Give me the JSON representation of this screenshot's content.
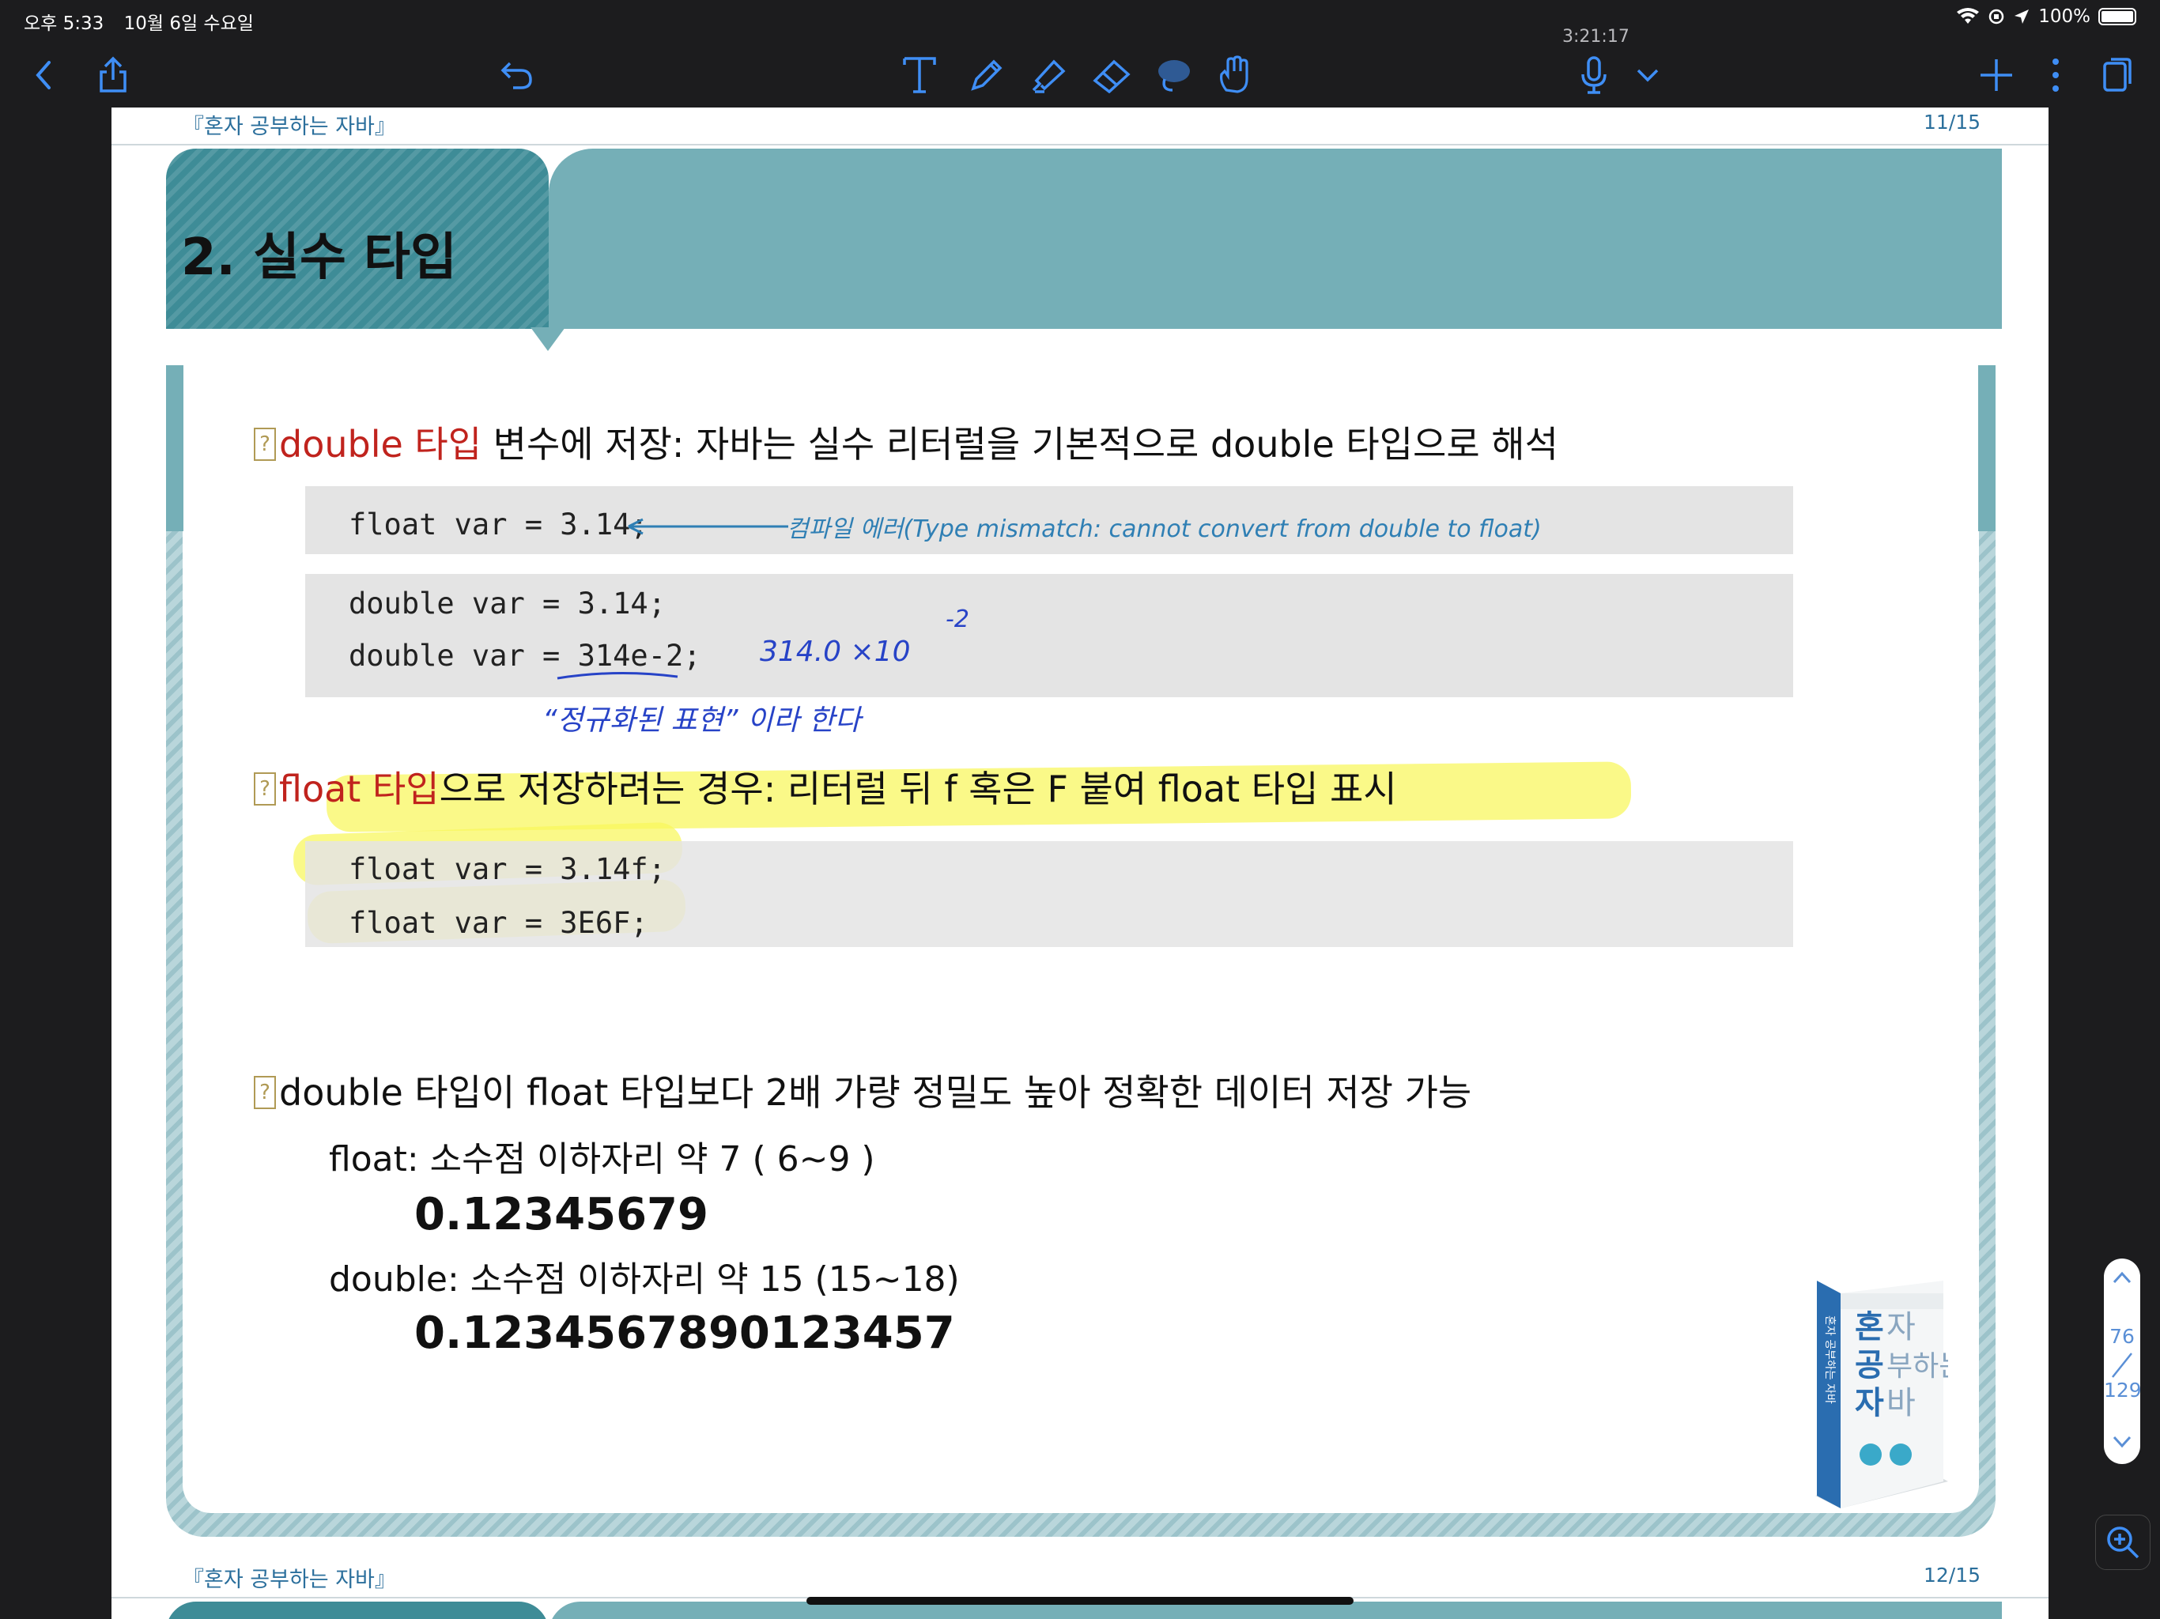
{
  "status_bar": {
    "time": "오후 5:33",
    "date": "10월 6일 수요일",
    "battery": "100%"
  },
  "recording": {
    "elapsed": "3:21:17"
  },
  "toolbar": {
    "icons": [
      "back-chevron-icon",
      "share-icon",
      "undo-icon",
      "text-tool-icon",
      "pen-tool-icon",
      "highlighter-tool-icon",
      "eraser-tool-icon",
      "lasso-tool-icon",
      "hand-tool-icon",
      "microphone-icon",
      "chevron-down-icon",
      "add-icon",
      "more-icon",
      "pages-icon"
    ]
  },
  "page_top": {
    "running_head": "『혼자 공부하는 자바』",
    "page_num": "11/15"
  },
  "section": {
    "title": "2. 실수 타입"
  },
  "bullets": {
    "b1": {
      "red": "double 타입",
      "rest": " 변수에 저장: 자바는 실수 리터럴을 기본적으로  double 타입으로 해석"
    },
    "b2": {
      "red": "float 타입",
      "rest": "으로 저장하려는 경우: 리터럴 뒤  f 혹은 F 붙여 float 타입 표시"
    },
    "b3": {
      "text": "double 타입이 float 타입보다 2배 가량 정밀도 높아 정확한 데이터 저장 가능"
    },
    "qmark": "?"
  },
  "code": {
    "c1": "float var = 3.14;",
    "c2": "double var = 3.14;",
    "c3": "double var = 314e-2;",
    "c4": "float var = 3.14f;",
    "c5": "float var = 3E6F;"
  },
  "handwriting": {
    "error_note": "컴파일 에러(Type mismatch: cannot convert from double to float)",
    "math": "314.0 ×10",
    "exponent": "-2",
    "normalized": "“정규화된 표현” 이라 한다"
  },
  "precision": {
    "float_line": "float: 소수점 이하자리 약 7 ( 6~9 )",
    "float_value": "0.12345679",
    "double_line": "double: 소수점 이하자리 약 15  (15~18)",
    "double_value": "0.1234567890123457"
  },
  "book": {
    "title_big": "혼자 공부하는 자바",
    "spine": "혼자 공부하는 자바"
  },
  "page_bottom": {
    "running_head": "『혼자 공부하는 자바』",
    "page_num": "12/15"
  },
  "page_scroller": {
    "current": "76",
    "total": "129"
  },
  "colors": {
    "banner_dark": "#3e8c97",
    "banner_light": "#75afb7",
    "keyword_red": "#c0231d",
    "highlight": "#f8f65a",
    "ink_blue": "#2743c7",
    "ink_teal": "#2f7fb4"
  }
}
